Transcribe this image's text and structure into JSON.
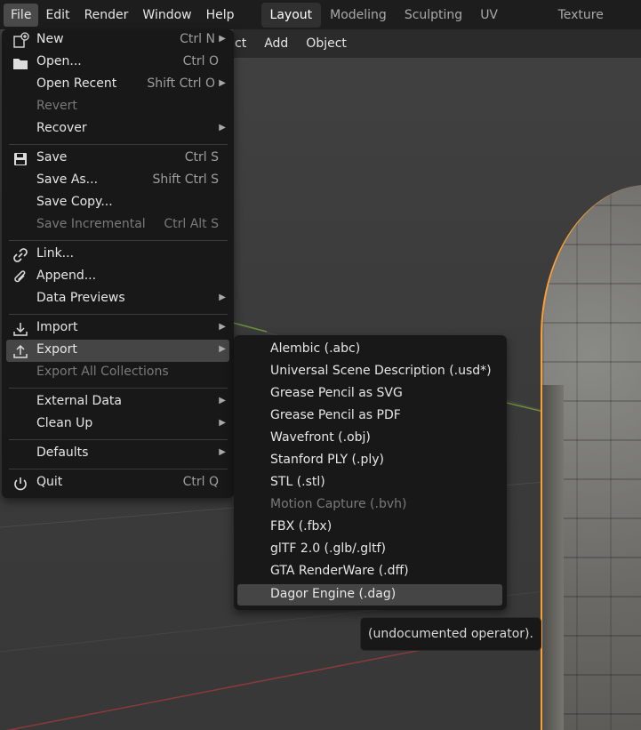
{
  "topbar": {
    "menus": [
      "File",
      "Edit",
      "Render",
      "Window",
      "Help"
    ],
    "workspaces": [
      "Layout",
      "Modeling",
      "Sculpting",
      "UV Editing",
      "Texture Paint"
    ],
    "active_workspace": "Layout"
  },
  "viewport_header": {
    "items": [
      "ct",
      "Add",
      "Object"
    ]
  },
  "file_menu": {
    "items": [
      {
        "label": "New",
        "shortcut": "Ctrl N",
        "icon": "new-file-icon",
        "arrow": true
      },
      {
        "label": "Open...",
        "shortcut": "Ctrl O",
        "icon": "folder-icon"
      },
      {
        "label": "Open Recent",
        "shortcut": "Shift Ctrl O",
        "arrow": true
      },
      {
        "label": "Revert",
        "disabled": true
      },
      {
        "label": "Recover",
        "arrow": true
      },
      {
        "label": "Save",
        "shortcut": "Ctrl S",
        "icon": "save-icon"
      },
      {
        "label": "Save As...",
        "shortcut": "Shift Ctrl S"
      },
      {
        "label": "Save Copy..."
      },
      {
        "label": "Save Incremental",
        "shortcut": "Ctrl Alt S",
        "disabled": true
      },
      {
        "label": "Link...",
        "icon": "link-icon"
      },
      {
        "label": "Append...",
        "icon": "paperclip-icon"
      },
      {
        "label": "Data Previews",
        "arrow": true
      },
      {
        "label": "Import",
        "icon": "import-icon",
        "arrow": true
      },
      {
        "label": "Export",
        "icon": "export-icon",
        "arrow": true,
        "highlighted": true
      },
      {
        "label": "Export All Collections",
        "disabled": true
      },
      {
        "label": "External Data",
        "arrow": true
      },
      {
        "label": "Clean Up",
        "arrow": true
      },
      {
        "label": "Defaults",
        "arrow": true
      },
      {
        "label": "Quit",
        "shortcut": "Ctrl Q",
        "icon": "power-icon"
      }
    ]
  },
  "export_menu": {
    "items": [
      {
        "label": "Alembic (.abc)"
      },
      {
        "label": "Universal Scene Description (.usd*)"
      },
      {
        "label": "Grease Pencil as SVG"
      },
      {
        "label": "Grease Pencil as PDF"
      },
      {
        "label": "Wavefront (.obj)"
      },
      {
        "label": "Stanford PLY (.ply)"
      },
      {
        "label": "STL (.stl)"
      },
      {
        "label": "Motion Capture (.bvh)",
        "disabled": true
      },
      {
        "label": "FBX (.fbx)"
      },
      {
        "label": "glTF 2.0 (.glb/.gltf)"
      },
      {
        "label": "GTA RenderWare (.dff)"
      },
      {
        "label": "Dagor Engine (.dag)",
        "highlighted": true
      }
    ]
  },
  "tooltip": {
    "text": "(undocumented operator)."
  },
  "colors": {
    "selection_outline": "#ffa033",
    "menu_bg": "#181818",
    "highlight_bg": "#454545"
  }
}
